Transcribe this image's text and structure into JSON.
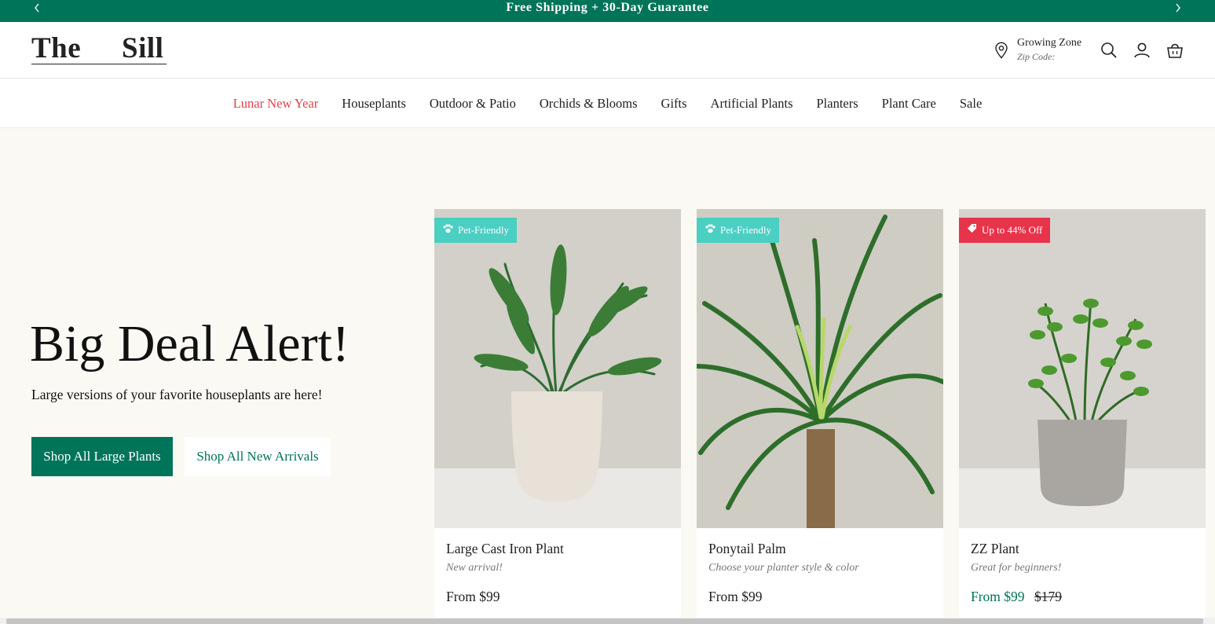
{
  "announcement": {
    "message": "Free Shipping + 30-Day Guarantee",
    "prev_icon": "chevron-left-icon",
    "next_icon": "chevron-right-icon"
  },
  "header": {
    "logo_word1": "The",
    "logo_word2": "Sill",
    "growing_zone_label": "Growing Zone",
    "zip_label": "Zip Code:",
    "icons": [
      "location-pin-icon",
      "search-icon",
      "account-icon",
      "cart-icon"
    ]
  },
  "nav": {
    "items": [
      {
        "label": "Lunar New Year",
        "color": "#e2424f"
      },
      {
        "label": "Houseplants"
      },
      {
        "label": "Outdoor & Patio"
      },
      {
        "label": "Orchids & Blooms"
      },
      {
        "label": "Gifts"
      },
      {
        "label": "Artificial Plants"
      },
      {
        "label": "Planters"
      },
      {
        "label": "Plant Care"
      },
      {
        "label": "Sale"
      }
    ]
  },
  "hero": {
    "title": "Big Deal Alert!",
    "subtitle": "Large versions of your favorite houseplants are here!",
    "primary_button": "Shop All Large Plants",
    "secondary_button": "Shop All New Arrivals"
  },
  "products": [
    {
      "badge": "Pet-Friendly",
      "badge_icon": "paw-icon",
      "badge_color": "#4bcfc3",
      "name": "Large Cast Iron Plant",
      "tagline": "New arrival!",
      "price": "From $99"
    },
    {
      "badge": "Pet-Friendly",
      "badge_icon": "paw-icon",
      "badge_color": "#4bcfc3",
      "name": "Ponytail Palm",
      "tagline": "Choose your planter style & color",
      "price": "From $99"
    },
    {
      "badge": "Up to 44% Off",
      "badge_icon": "tag-icon",
      "badge_color": "#e8344b",
      "name": "ZZ Plant",
      "tagline": "Great for beginners!",
      "price": "From $99",
      "was_price": "$179"
    }
  ],
  "colors": {
    "brand_green": "#007459",
    "accent_red": "#e2424f",
    "background": "#fbf9f3"
  }
}
